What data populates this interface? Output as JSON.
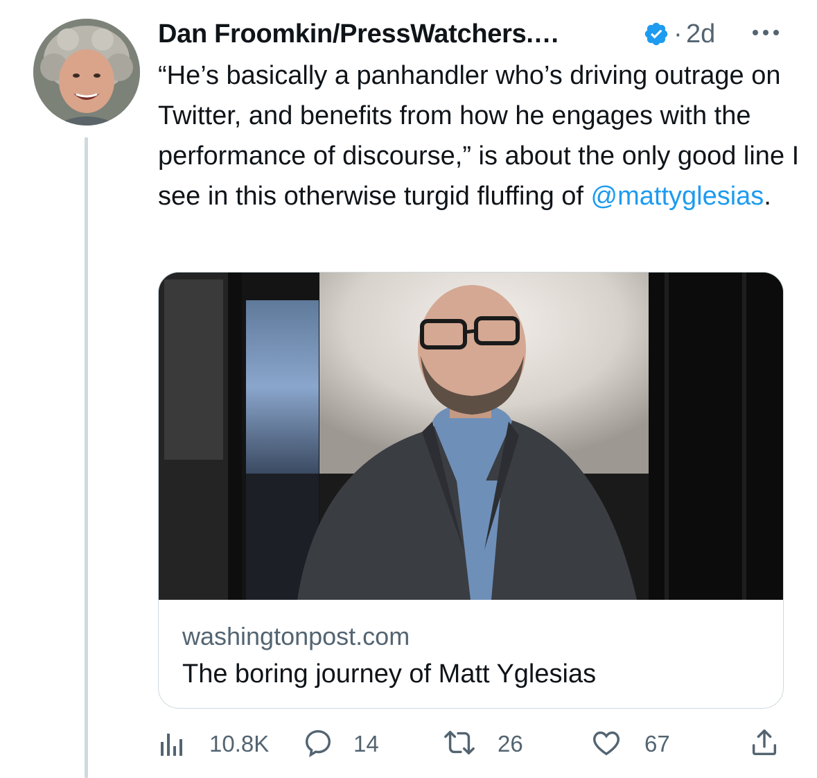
{
  "author": {
    "display_name": "Dan Froomkin/PressWatchers.…",
    "separator": "·",
    "timestamp": "2d"
  },
  "tweet": {
    "text_before_mention": "“He’s basically a panhandler who’s driving outrage on Twitter, and benefits from how he engages with the performance of discourse,” is about the only good line I see in this otherwise turgid fluffing of ",
    "mention": "@mattyglesias",
    "text_after_mention": "."
  },
  "card": {
    "domain": "washingtonpost.com",
    "title": "The boring journey of Matt Yglesias"
  },
  "actions": {
    "views": "10.8K",
    "replies": "14",
    "retweets": "26",
    "likes": "67"
  },
  "colors": {
    "accent": "#1d9bf0",
    "muted": "#536471",
    "border": "#cfd9de"
  },
  "icons": [
    "verified-badge-icon",
    "more-options-icon",
    "views-icon",
    "reply-icon",
    "retweet-icon",
    "like-icon",
    "share-icon"
  ]
}
